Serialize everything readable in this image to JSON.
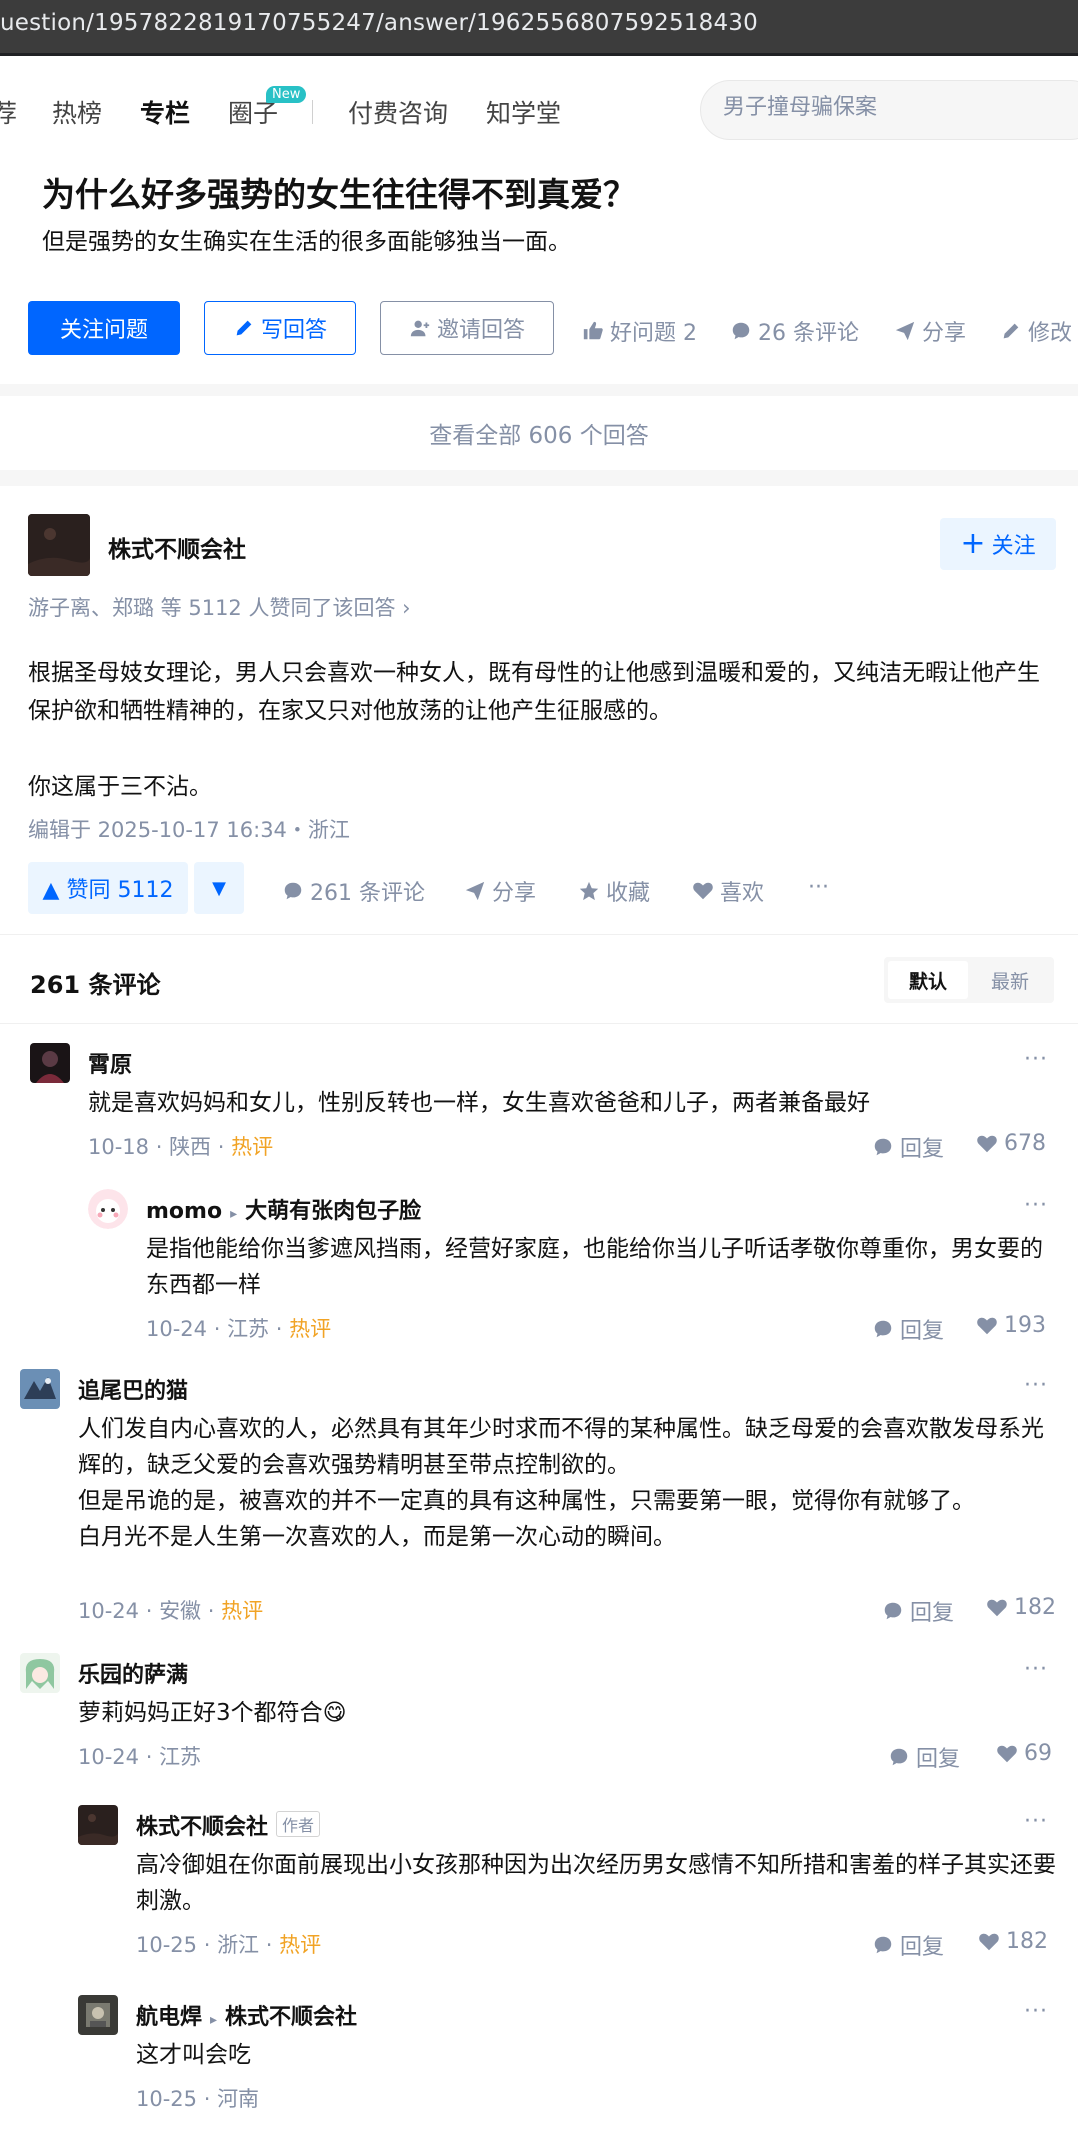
{
  "browser": {
    "url": "uestion/1957822819170755247/answer/1962556807592518430"
  },
  "nav": {
    "items": [
      "荐",
      "热榜",
      "专栏",
      "圈子",
      "付费咨询",
      "知学堂"
    ],
    "new_badge": "New",
    "search_placeholder": "男子撞母骗保案"
  },
  "question": {
    "title": "为什么好多强势的女生往往得不到真爱？",
    "detail": "但是强势的女生确实在生活的很多面能够独当一面。",
    "follow_label": "关注问题",
    "write_label": "写回答",
    "invite_label": "邀请回答",
    "good_label": "好问题 2",
    "comments_label": "26 条评论",
    "share_label": "分享",
    "edit_label": "修改"
  },
  "view_all": "查看全部 606 个回答",
  "answer": {
    "author": "株式不顺会社",
    "follow_label": "关注",
    "voters": "游子离、郑璐 等 5112 人赞同了该回答 ›",
    "paragraph1": "根据圣母妓女理论，男人只会喜欢一种女人，既有母性的让他感到温暖和爱的，又纯洁无暇让他产生保护欲和牺牲精神的，在家又只对他放荡的让他产生征服感的。",
    "paragraph2": "你这属于三不沾。",
    "edited": "编辑于 2025-10-17 16:34・浙江",
    "vote_label": "▲ 赞同 5112",
    "comments_label": "261 条评论",
    "share_label": "分享",
    "collect_label": "收藏",
    "like_label": "喜欢",
    "more_label": "···"
  },
  "comments": {
    "header": "261 条评论",
    "sort_default": "默认",
    "sort_latest": "最新",
    "reply_label": "回复",
    "author_tag": "作者",
    "items": [
      {
        "name": "霄原",
        "text": "就是喜欢妈妈和女儿，性别反转也一样，女生喜欢爸爸和儿子，两者兼备最好",
        "date": "10-18",
        "region": "陕西",
        "hot": "热评",
        "likes": "678"
      },
      {
        "name": "momo",
        "reply_to": "大萌有张肉包子脸",
        "text": "是指他能给你当爹遮风挡雨，经营好家庭，也能给你当儿子听话孝敬你尊重你，男女要的东西都一样",
        "date": "10-24",
        "region": "江苏",
        "hot": "热评",
        "likes": "193"
      },
      {
        "name": "追尾巴的猫",
        "text1": "人们发自内心喜欢的人，必然具有其年少时求而不得的某种属性。缺乏母爱的会喜欢散发母系光辉的，缺乏父爱的会喜欢强势精明甚至带点控制欲的。",
        "text2": "但是吊诡的是，被喜欢的并不一定真的具有这种属性，只需要第一眼，觉得你有就够了。",
        "text3": "白月光不是人生第一次喜欢的人，而是第一次心动的瞬间。",
        "date": "10-24",
        "region": "安徽",
        "hot": "热评",
        "likes": "182"
      },
      {
        "name": "乐园的萨满",
        "text": "萝莉妈妈正好3个都符合",
        "emoji": "😋",
        "date": "10-24",
        "region": "江苏",
        "likes": "69"
      },
      {
        "name": "株式不顺会社",
        "text": "高冷御姐在你面前展现出小女孩那种因为出次经历男女感情不知所措和害羞的样子其实还要刺激。",
        "date": "10-25",
        "region": "浙江",
        "hot": "热评",
        "likes": "182"
      },
      {
        "name": "航电焊",
        "reply_to": "株式不顺会社",
        "text": "这才叫会吃",
        "date": "10-25",
        "region": "河南"
      }
    ]
  },
  "colors": {
    "brand": "#0066ff",
    "muted": "#8590a6",
    "hot": "#f1a325",
    "badge": "#28c1c6"
  }
}
